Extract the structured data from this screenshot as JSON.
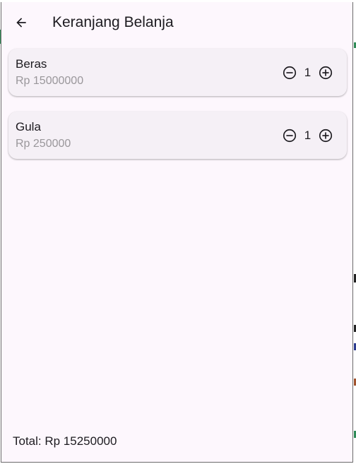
{
  "appbar": {
    "title": "Keranjang Belanja",
    "back_icon": "arrow-back-icon"
  },
  "cart": {
    "items": [
      {
        "name": "Beras",
        "price": "Rp 15000000",
        "quantity": "1"
      },
      {
        "name": "Gula",
        "price": "Rp 250000",
        "quantity": "1"
      }
    ]
  },
  "footer": {
    "total": "Total: Rp 15250000"
  },
  "colors": {
    "background": "#fdf7fd",
    "card": "#f5f0f6",
    "text": "#1d1b20",
    "secondary_text": "#9a979b"
  }
}
